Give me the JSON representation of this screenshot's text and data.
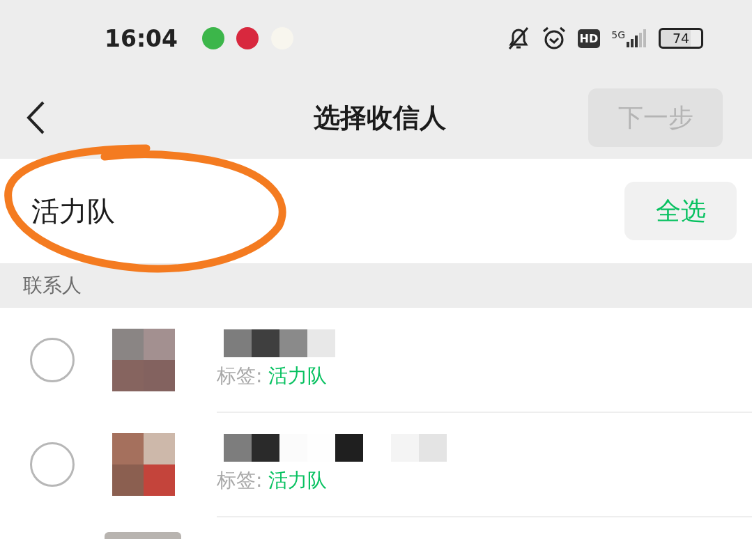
{
  "status_bar": {
    "time": "16:04",
    "network": "5G",
    "battery": "74",
    "hd": "HD"
  },
  "header": {
    "title": "选择收信人",
    "next_button": {
      "label": "下一步",
      "disabled": true
    }
  },
  "tag_header": {
    "name": "活力队",
    "select_all": "全选"
  },
  "section": {
    "title": "联系人"
  },
  "contacts": [
    {
      "selected": false,
      "tag_label": "标签: ",
      "tag": "活力队"
    },
    {
      "selected": false,
      "tag_label": "标签: ",
      "tag": "活力队"
    }
  ]
}
